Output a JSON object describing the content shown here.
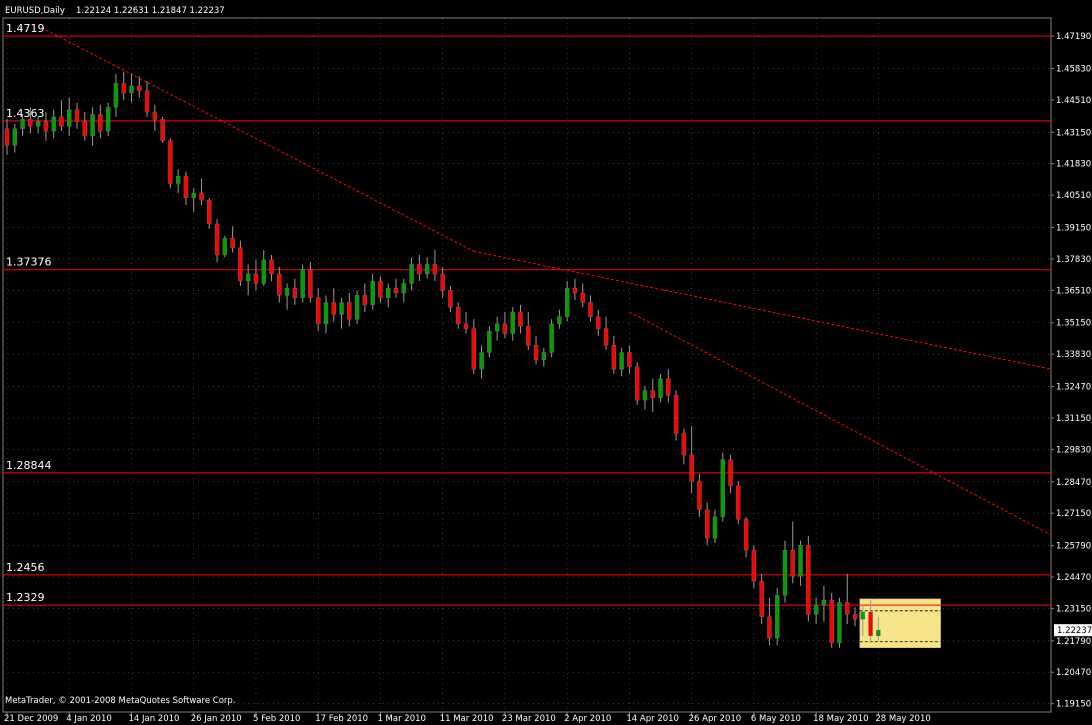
{
  "header": {
    "symbol": "EURUSD,Daily",
    "ohlc": "1.22124 1.22631 1.21847 1.22237"
  },
  "copyright": "MetaTrader, © 2001-2008 MetaQuotes Software Corp.",
  "colors": {
    "background": "#000000",
    "bull": "#00a000",
    "bear": "#ff0000",
    "wick": "#9a9a9a",
    "level_line": "#ff0000",
    "trend_line": "#ff0000",
    "grid": "#5a5a5a",
    "axis": "#808080",
    "text": "#ffffff",
    "highlight_box": "#f5e48a"
  },
  "chart_data": {
    "type": "candlestick",
    "symbol": "EURUSD",
    "timeframe": "Daily",
    "y_axis_labels": [
      "1.47190",
      "1.45830",
      "1.44510",
      "1.43150",
      "1.41830",
      "1.40510",
      "1.39150",
      "1.37830",
      "1.36510",
      "1.35150",
      "1.33830",
      "1.32470",
      "1.31150",
      "1.29830",
      "1.28470",
      "1.27150",
      "1.25790",
      "1.24470",
      "1.23150",
      "1.21790",
      "1.20470",
      "1.19150"
    ],
    "y_axis_values": [
      1.4719,
      1.4583,
      1.4451,
      1.4315,
      1.4183,
      1.4051,
      1.3915,
      1.3783,
      1.3651,
      1.3515,
      1.3383,
      1.3247,
      1.3115,
      1.2983,
      1.2847,
      1.2715,
      1.2579,
      1.2447,
      1.2315,
      1.2179,
      1.2047,
      1.1915
    ],
    "ylim": [
      1.188,
      1.4795
    ],
    "current_price": "1.22237",
    "current_price_value": 1.22237,
    "x_axis_labels": [
      "21 Dec 2009",
      "4 Jan 2010",
      "14 Jan 2010",
      "26 Jan 2010",
      "5 Feb 2010",
      "17 Feb 2010",
      "1 Mar 2010",
      "11 Mar 2010",
      "23 Mar 2010",
      "2 Apr 2010",
      "14 Apr 2010",
      "26 Apr 2010",
      "6 May 2010",
      "18 May 2010",
      "28 May 2010"
    ],
    "x_axis_bar_index": [
      0,
      8,
      16,
      24,
      32,
      40,
      48,
      56,
      64,
      72,
      80,
      88,
      96,
      104,
      112
    ],
    "bar_count": 118,
    "horizontal_levels": [
      {
        "label": "1.4719",
        "value": 1.4719
      },
      {
        "label": "1.4363",
        "value": 1.4363
      },
      {
        "label": "1.37376",
        "value": 1.37376
      },
      {
        "label": "1.28844",
        "value": 1.28844
      },
      {
        "label": "1.2456",
        "value": 1.2456
      },
      {
        "label": "1.2329",
        "value": 1.2329
      }
    ],
    "trend_lines": [
      {
        "from": {
          "bar": 5,
          "price": 1.4745
        },
        "to": {
          "bar": 60,
          "price": 1.3815
        }
      },
      {
        "from": {
          "bar": 60,
          "price": 1.3815
        },
        "to": {
          "bar": 135,
          "price": 1.3315
        }
      },
      {
        "from": {
          "bar": 80,
          "price": 1.356
        },
        "to": {
          "bar": 135,
          "price": 1.261
        }
      }
    ],
    "highlight_box": {
      "bar_start": 110,
      "bar_end": 120,
      "price_top": 1.2355,
      "price_bottom": 1.215
    },
    "box_dashed_levels": [
      1.2305,
      1.2175
    ],
    "ohlc": [
      [
        1.433,
        1.437,
        1.422,
        1.426
      ],
      [
        1.426,
        1.435,
        1.423,
        1.433
      ],
      [
        1.433,
        1.439,
        1.43,
        1.437
      ],
      [
        1.437,
        1.442,
        1.431,
        1.434
      ],
      [
        1.434,
        1.438,
        1.431,
        1.436
      ],
      [
        1.436,
        1.44,
        1.428,
        1.432
      ],
      [
        1.432,
        1.441,
        1.429,
        1.438
      ],
      [
        1.438,
        1.445,
        1.432,
        1.434
      ],
      [
        1.434,
        1.446,
        1.43,
        1.441
      ],
      [
        1.441,
        1.444,
        1.433,
        1.436
      ],
      [
        1.436,
        1.44,
        1.428,
        1.43
      ],
      [
        1.43,
        1.442,
        1.426,
        1.439
      ],
      [
        1.439,
        1.443,
        1.429,
        1.432
      ],
      [
        1.432,
        1.444,
        1.43,
        1.442
      ],
      [
        1.442,
        1.456,
        1.438,
        1.452
      ],
      [
        1.452,
        1.457,
        1.445,
        1.448
      ],
      [
        1.448,
        1.456,
        1.444,
        1.451
      ],
      [
        1.451,
        1.455,
        1.446,
        1.449
      ],
      [
        1.449,
        1.453,
        1.438,
        1.44
      ],
      [
        1.44,
        1.443,
        1.432,
        1.437
      ],
      [
        1.437,
        1.438,
        1.427,
        1.428
      ],
      [
        1.428,
        1.429,
        1.408,
        1.41
      ],
      [
        1.41,
        1.416,
        1.406,
        1.413
      ],
      [
        1.413,
        1.415,
        1.401,
        1.404
      ],
      [
        1.404,
        1.408,
        1.398,
        1.406
      ],
      [
        1.406,
        1.412,
        1.401,
        1.403
      ],
      [
        1.403,
        1.404,
        1.391,
        1.393
      ],
      [
        1.393,
        1.395,
        1.377,
        1.38
      ],
      [
        1.38,
        1.388,
        1.379,
        1.387
      ],
      [
        1.387,
        1.392,
        1.381,
        1.383
      ],
      [
        1.383,
        1.386,
        1.367,
        1.369
      ],
      [
        1.369,
        1.376,
        1.363,
        1.372
      ],
      [
        1.372,
        1.378,
        1.365,
        1.368
      ],
      [
        1.368,
        1.382,
        1.367,
        1.378
      ],
      [
        1.378,
        1.38,
        1.369,
        1.372
      ],
      [
        1.372,
        1.375,
        1.36,
        1.363
      ],
      [
        1.363,
        1.368,
        1.357,
        1.366
      ],
      [
        1.366,
        1.37,
        1.359,
        1.362
      ],
      [
        1.362,
        1.376,
        1.36,
        1.374
      ],
      [
        1.374,
        1.377,
        1.36,
        1.362
      ],
      [
        1.362,
        1.366,
        1.348,
        1.351
      ],
      [
        1.351,
        1.363,
        1.347,
        1.36
      ],
      [
        1.36,
        1.366,
        1.352,
        1.355
      ],
      [
        1.355,
        1.362,
        1.349,
        1.36
      ],
      [
        1.36,
        1.364,
        1.35,
        1.353
      ],
      [
        1.353,
        1.365,
        1.351,
        1.363
      ],
      [
        1.363,
        1.368,
        1.356,
        1.359
      ],
      [
        1.359,
        1.372,
        1.357,
        1.369
      ],
      [
        1.369,
        1.371,
        1.36,
        1.362
      ],
      [
        1.362,
        1.368,
        1.358,
        1.366
      ],
      [
        1.366,
        1.37,
        1.362,
        1.364
      ],
      [
        1.364,
        1.37,
        1.36,
        1.368
      ],
      [
        1.368,
        1.379,
        1.365,
        1.376
      ],
      [
        1.376,
        1.38,
        1.369,
        1.372
      ],
      [
        1.372,
        1.379,
        1.37,
        1.376
      ],
      [
        1.376,
        1.382,
        1.369,
        1.372
      ],
      [
        1.372,
        1.375,
        1.362,
        1.365
      ],
      [
        1.365,
        1.367,
        1.356,
        1.358
      ],
      [
        1.358,
        1.36,
        1.349,
        1.351
      ],
      [
        1.351,
        1.356,
        1.347,
        1.349
      ],
      [
        1.349,
        1.353,
        1.33,
        1.332
      ],
      [
        1.332,
        1.342,
        1.328,
        1.339
      ],
      [
        1.339,
        1.35,
        1.337,
        1.348
      ],
      [
        1.348,
        1.354,
        1.344,
        1.351
      ],
      [
        1.351,
        1.356,
        1.345,
        1.347
      ],
      [
        1.347,
        1.358,
        1.344,
        1.356
      ],
      [
        1.356,
        1.359,
        1.347,
        1.35
      ],
      [
        1.35,
        1.356,
        1.34,
        1.342
      ],
      [
        1.342,
        1.346,
        1.334,
        1.336
      ],
      [
        1.336,
        1.341,
        1.333,
        1.339
      ],
      [
        1.339,
        1.353,
        1.337,
        1.351
      ],
      [
        1.351,
        1.357,
        1.349,
        1.354
      ],
      [
        1.354,
        1.369,
        1.352,
        1.366
      ],
      [
        1.366,
        1.37,
        1.361,
        1.364
      ],
      [
        1.364,
        1.368,
        1.358,
        1.36
      ],
      [
        1.36,
        1.363,
        1.352,
        1.354
      ],
      [
        1.354,
        1.357,
        1.346,
        1.349
      ],
      [
        1.349,
        1.354,
        1.34,
        1.342
      ],
      [
        1.342,
        1.346,
        1.33,
        1.332
      ],
      [
        1.332,
        1.341,
        1.329,
        1.339
      ],
      [
        1.339,
        1.342,
        1.33,
        1.333
      ],
      [
        1.333,
        1.335,
        1.317,
        1.319
      ],
      [
        1.319,
        1.325,
        1.315,
        1.323
      ],
      [
        1.323,
        1.328,
        1.314,
        1.32
      ],
      [
        1.32,
        1.33,
        1.318,
        1.328
      ],
      [
        1.328,
        1.332,
        1.318,
        1.321
      ],
      [
        1.321,
        1.323,
        1.302,
        1.305
      ],
      [
        1.305,
        1.307,
        1.292,
        1.296
      ],
      [
        1.296,
        1.308,
        1.28,
        1.285
      ],
      [
        1.285,
        1.288,
        1.27,
        1.273
      ],
      [
        1.273,
        1.276,
        1.258,
        1.261
      ],
      [
        1.261,
        1.273,
        1.259,
        1.27
      ],
      [
        1.27,
        1.297,
        1.268,
        1.294
      ],
      [
        1.294,
        1.296,
        1.28,
        1.283
      ],
      [
        1.283,
        1.285,
        1.267,
        1.269
      ],
      [
        1.269,
        1.27,
        1.253,
        1.256
      ],
      [
        1.256,
        1.258,
        1.24,
        1.243
      ],
      [
        1.243,
        1.246,
        1.225,
        1.228
      ],
      [
        1.228,
        1.236,
        1.216,
        1.219
      ],
      [
        1.219,
        1.24,
        1.216,
        1.237
      ],
      [
        1.237,
        1.26,
        1.234,
        1.256
      ],
      [
        1.256,
        1.268,
        1.242,
        1.245
      ],
      [
        1.245,
        1.26,
        1.241,
        1.258
      ],
      [
        1.258,
        1.262,
        1.226,
        1.229
      ],
      [
        1.229,
        1.236,
        1.225,
        1.233
      ],
      [
        1.233,
        1.241,
        1.226,
        1.235
      ],
      [
        1.235,
        1.238,
        1.215,
        1.217
      ],
      [
        1.217,
        1.236,
        1.215,
        1.234
      ],
      [
        1.234,
        1.246,
        1.225,
        1.229
      ],
      [
        1.229,
        1.232,
        1.224,
        1.227
      ],
      [
        1.227,
        1.233,
        1.22,
        1.23
      ],
      [
        1.23,
        1.235,
        1.217,
        1.22
      ],
      [
        1.22,
        1.228,
        1.218,
        1.2224
      ]
    ]
  }
}
